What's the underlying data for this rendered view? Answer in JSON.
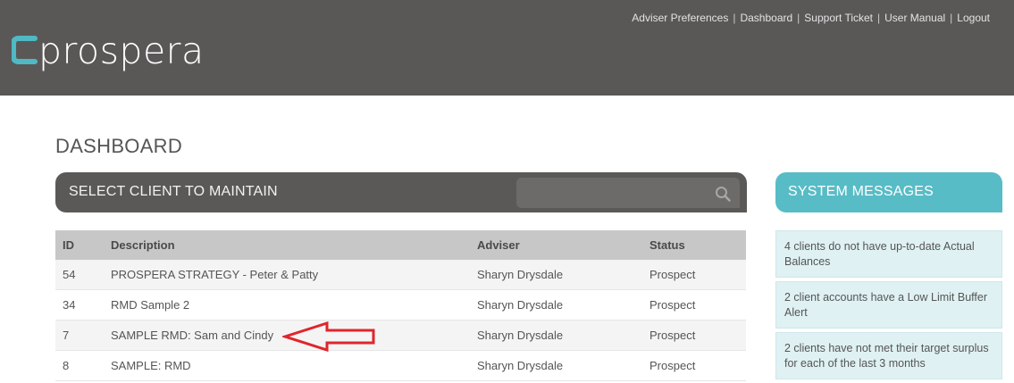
{
  "brand": {
    "logo_text": "prospera"
  },
  "topnav": {
    "links": [
      "Adviser Preferences",
      "Dashboard",
      "Support Ticket",
      "User Manual",
      "Logout"
    ]
  },
  "page_title": "DASHBOARD",
  "client_panel": {
    "title": "SELECT CLIENT TO MAINTAIN",
    "search_placeholder": "",
    "columns": [
      "ID",
      "Description",
      "Adviser",
      "Status"
    ],
    "rows": [
      {
        "id": "54",
        "description": "PROSPERA STRATEGY - Peter & Patty",
        "adviser": "Sharyn Drysdale",
        "status": "Prospect"
      },
      {
        "id": "34",
        "description": "RMD Sample 2",
        "adviser": "Sharyn Drysdale",
        "status": "Prospect"
      },
      {
        "id": "7",
        "description": "SAMPLE RMD: Sam and Cindy",
        "adviser": "Sharyn Drysdale",
        "status": "Prospect"
      },
      {
        "id": "8",
        "description": "SAMPLE: RMD",
        "adviser": "Sharyn Drysdale",
        "status": "Prospect"
      }
    ]
  },
  "system_messages": {
    "title": "SYSTEM MESSAGES",
    "items": [
      "4 clients do not have up-to-date Actual Balances",
      "2 client accounts have a Low Limit Buffer Alert",
      "2 clients have not met their target surplus for each of the last 3 months"
    ]
  },
  "colors": {
    "header_bg": "#5a5857",
    "panel_header_bg": "#5b5958",
    "accent_teal": "#57bcc6",
    "annotation_arrow": "#e0252b"
  },
  "icons": {
    "search": "search-icon",
    "annotation": "arrow-left-icon"
  }
}
